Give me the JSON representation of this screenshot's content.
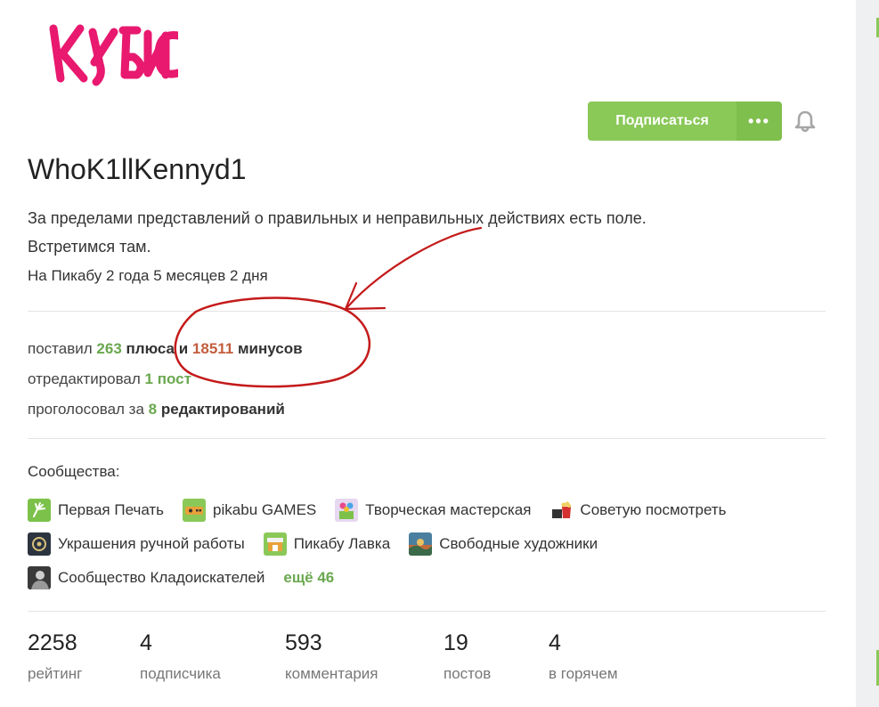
{
  "profile": {
    "username": "WhoK1llKennyd1",
    "bio_line1": "За пределами представлений о правильных и неправильных действиях есть поле.",
    "bio_line2": "Встретимся там.",
    "since": "На Пикабу 2 года 5 месяцев 2 дня",
    "logo_text": "КУБИС"
  },
  "actions": {
    "subscribe_label": "Подписаться",
    "more_label": "•••"
  },
  "activity": {
    "line1_prefix": "поставил",
    "pluses": "263",
    "pluses_word": "плюса и",
    "minuses": "18511",
    "minuses_word": "минусов",
    "line2_prefix": "отредактировал",
    "edited_posts": "1 пост",
    "line3_prefix": "проголосовал за",
    "voted_count": "8",
    "voted_word": "редактирований"
  },
  "communities": {
    "title": "Сообщества:",
    "items": [
      {
        "label": "Первая Печать",
        "icon": "hand-print-icon"
      },
      {
        "label": "pikabu GAMES",
        "icon": "gamepad-icon"
      },
      {
        "label": "Творческая мастерская",
        "icon": "craft-workshop-icon"
      },
      {
        "label": "Советую посмотреть",
        "icon": "film-popcorn-icon"
      },
      {
        "label": "Украшения ручной работы",
        "icon": "jewelry-icon"
      },
      {
        "label": "Пикабу Лавка",
        "icon": "shop-icon"
      },
      {
        "label": "Свободные художники",
        "icon": "painting-icon"
      },
      {
        "label": "Сообщество Кладоискателей",
        "icon": "treasure-hunter-icon"
      }
    ],
    "more_label": "ещё 46"
  },
  "stats": [
    {
      "value": "2258",
      "label": "рейтинг"
    },
    {
      "value": "4",
      "label": "подписчика"
    },
    {
      "value": "593",
      "label": "комментария"
    },
    {
      "value": "19",
      "label": "постов"
    },
    {
      "value": "4",
      "label": "в горячем"
    }
  ],
  "colors": {
    "accent_green": "#8ac858",
    "positive": "#6aa84f",
    "negative": "#c25e3e",
    "logo_pink": "#e8196f",
    "annotation_red": "#c41a1a"
  }
}
